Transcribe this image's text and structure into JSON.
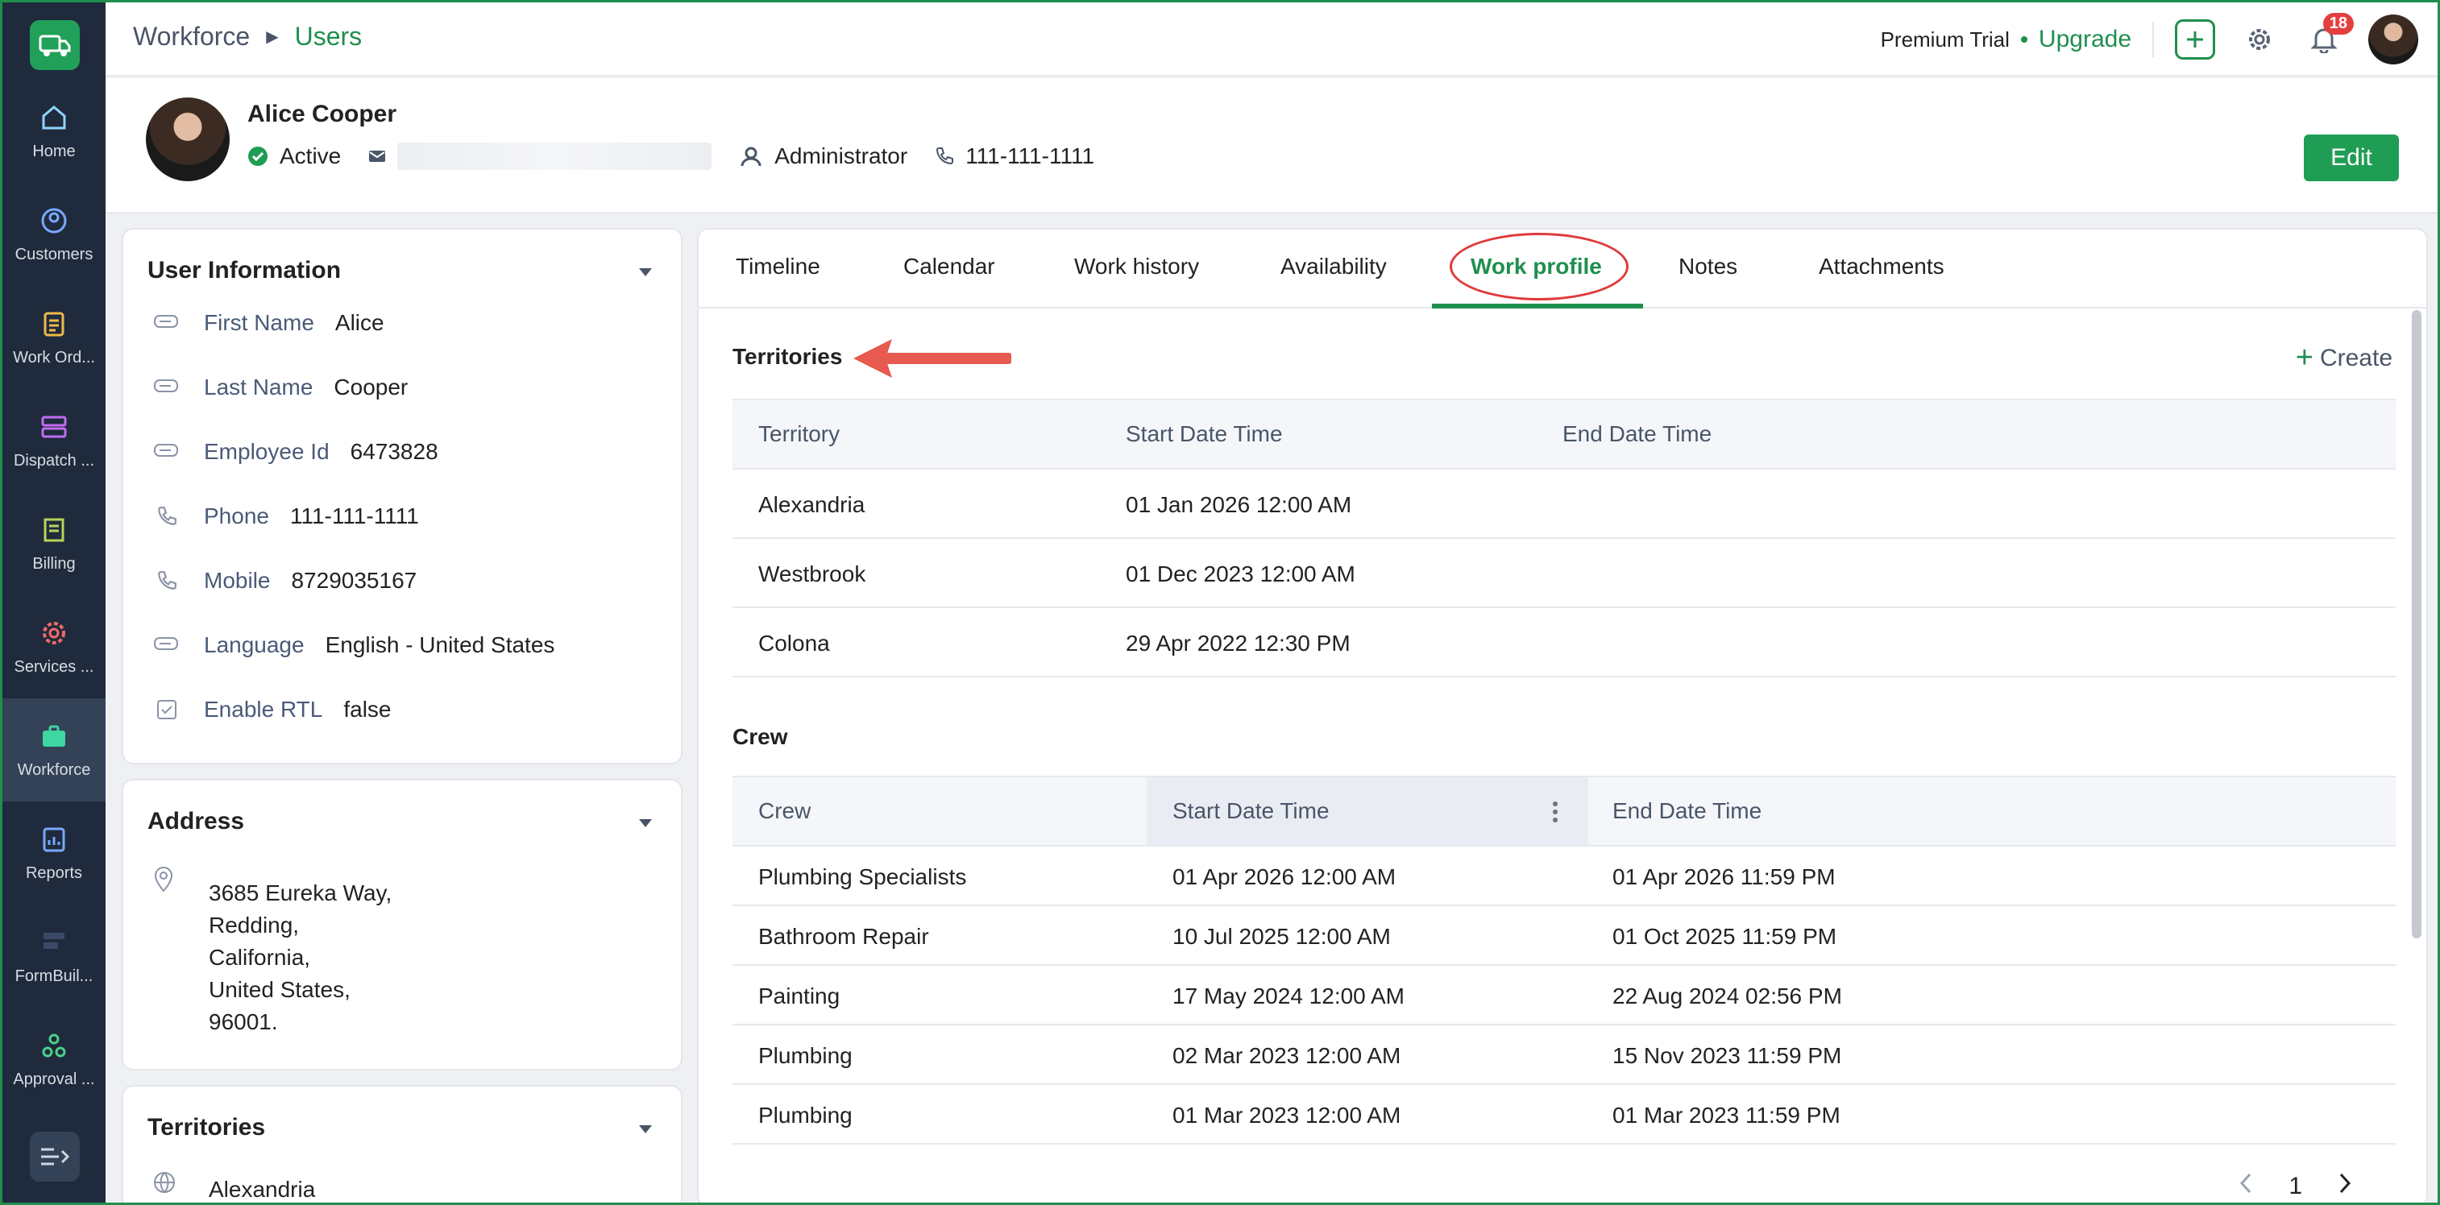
{
  "nav": {
    "items": [
      {
        "label": "Home",
        "icon": "home-icon",
        "color": "#8fd3ff"
      },
      {
        "label": "Customers",
        "icon": "customers-icon",
        "color": "#7aa8ff"
      },
      {
        "label": "Work Ord...",
        "icon": "work-orders-icon",
        "color": "#f0b94a"
      },
      {
        "label": "Dispatch ...",
        "icon": "dispatch-icon",
        "color": "#c06cf0"
      },
      {
        "label": "Billing",
        "icon": "billing-icon",
        "color": "#b9d35a"
      },
      {
        "label": "Services ...",
        "icon": "services-icon",
        "color": "#f06a6a"
      },
      {
        "label": "Workforce",
        "icon": "workforce-icon",
        "color": "#3ed6a3"
      },
      {
        "label": "Reports",
        "icon": "reports-icon",
        "color": "#7aa8ff"
      },
      {
        "label": "FormBuil...",
        "icon": "formbuilder-icon",
        "color": "#3a4a66"
      },
      {
        "label": "Approval ...",
        "icon": "approval-icon",
        "color": "#4ad08a"
      }
    ]
  },
  "topbar": {
    "breadcrumb_root": "Workforce",
    "breadcrumb_current": "Users",
    "trial_label": "Premium Trial",
    "upgrade_label": "Upgrade",
    "notification_count": "18"
  },
  "profile": {
    "name": "Alice Cooper",
    "status": "Active",
    "role": "Administrator",
    "phone": "111-111-1111",
    "edit_label": "Edit"
  },
  "user_info": {
    "title": "User Information",
    "fields": [
      {
        "label": "First Name",
        "value": "Alice"
      },
      {
        "label": "Last Name",
        "value": "Cooper"
      },
      {
        "label": "Employee Id",
        "value": "6473828"
      },
      {
        "label": "Phone",
        "value": "111-111-1111"
      },
      {
        "label": "Mobile",
        "value": "8729035167"
      },
      {
        "label": "Language",
        "value": "English - United States"
      },
      {
        "label": "Enable RTL",
        "value": "false"
      }
    ]
  },
  "address": {
    "title": "Address",
    "lines": [
      "3685 Eureka Way,",
      "Redding,",
      "California,",
      "United States,",
      "96001."
    ]
  },
  "territories_card": {
    "title": "Territories",
    "first_item": "Alexandria"
  },
  "tabs": [
    "Timeline",
    "Calendar",
    "Work history",
    "Availability",
    "Work profile",
    "Notes",
    "Attachments"
  ],
  "territories": {
    "title": "Territories",
    "create_label": "Create",
    "columns": [
      "Territory",
      "Start Date Time",
      "End Date Time"
    ],
    "rows": [
      [
        "Alexandria",
        "01 Jan 2026 12:00 AM",
        ""
      ],
      [
        "Westbrook",
        "01 Dec 2023 12:00 AM",
        ""
      ],
      [
        "Colona",
        "29 Apr 2022 12:30 PM",
        ""
      ]
    ]
  },
  "crew": {
    "title": "Crew",
    "columns": [
      "Crew",
      "Start Date Time",
      "End Date Time"
    ],
    "rows": [
      [
        "Plumbing Specialists",
        "01 Apr 2026 12:00 AM",
        "01 Apr 2026 11:59 PM"
      ],
      [
        "Bathroom Repair",
        "10 Jul 2025 12:00 AM",
        "01 Oct 2025 11:59 PM"
      ],
      [
        "Painting",
        "17 May 2024 12:00 AM",
        "22 Aug 2024 02:56 PM"
      ],
      [
        "Plumbing",
        "02 Mar 2023 12:00 AM",
        "15 Nov 2023 11:59 PM"
      ],
      [
        "Plumbing",
        "01 Mar 2023 12:00 AM",
        "01 Mar 2023 11:59 PM"
      ]
    ]
  },
  "pager": {
    "page": "1"
  },
  "colors": {
    "accent": "#1f8f4e",
    "annotation": "#e03a3a"
  }
}
